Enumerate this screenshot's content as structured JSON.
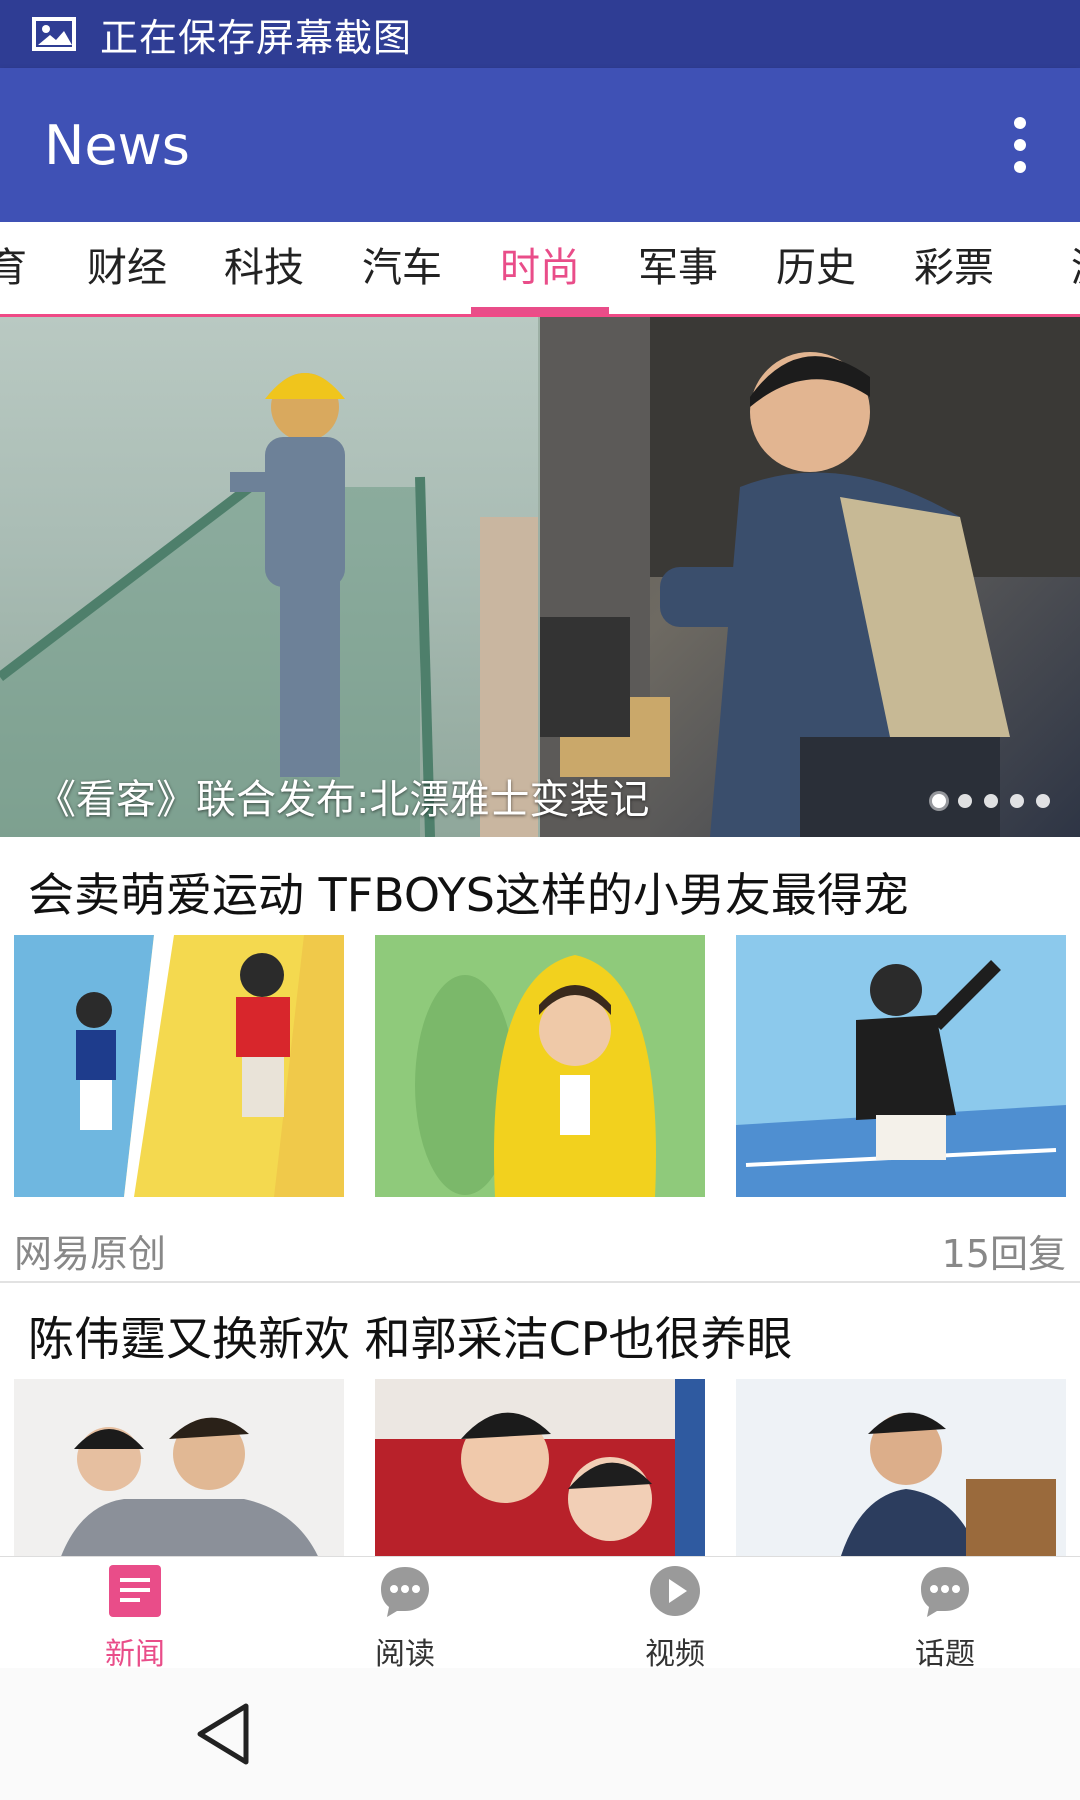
{
  "status_bar": {
    "text": "正在保存屏幕截图",
    "icon": "image-icon"
  },
  "app_bar": {
    "title": "News",
    "menu_icon": "more-vert-icon"
  },
  "tabs": [
    {
      "label": "育",
      "active": false
    },
    {
      "label": "财经",
      "active": false
    },
    {
      "label": "科技",
      "active": false
    },
    {
      "label": "汽车",
      "active": false
    },
    {
      "label": "时尚",
      "active": true
    },
    {
      "label": "军事",
      "active": false
    },
    {
      "label": "历史",
      "active": false
    },
    {
      "label": "彩票",
      "active": false
    },
    {
      "label": "游",
      "active": false
    }
  ],
  "banner": {
    "caption": "《看客》联合发布:北漂雅士变装记",
    "dots": 5,
    "active_dot": 0
  },
  "articles": [
    {
      "headline": "会卖萌爱运动 TFBOYS这样的小男友最得宠",
      "source": "网易原创",
      "replies": "15回复"
    },
    {
      "headline": "陈伟霆又换新欢 和郭采洁CP也很养眼"
    }
  ],
  "bottom_nav": [
    {
      "label": "新闻",
      "icon": "news-icon",
      "active": true
    },
    {
      "label": "阅读",
      "icon": "chat-bubble-icon",
      "active": false
    },
    {
      "label": "视频",
      "icon": "play-icon",
      "active": false
    },
    {
      "label": "话题",
      "icon": "chat-bubble-icon",
      "active": false
    }
  ],
  "colors": {
    "primary": "#3f51b5",
    "primary_dark": "#2f3d94",
    "accent": "#e94d89"
  }
}
